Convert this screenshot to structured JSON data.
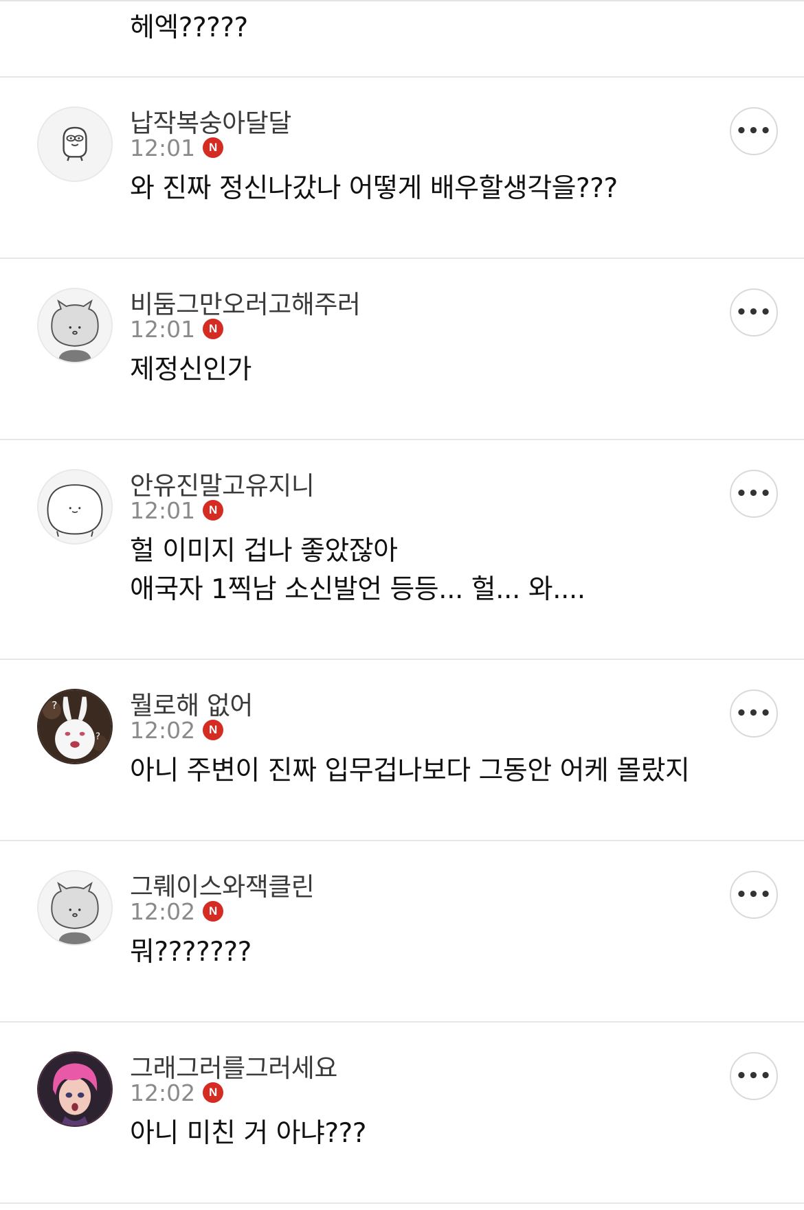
{
  "top_comment": {
    "text": "헤엑?????"
  },
  "comments": [
    {
      "nickname": "납작복숭아달달",
      "time": "12:01",
      "badge": "N",
      "lines": [
        "와 진짜 정신나갔나 어떻게 배우할생각을???"
      ],
      "avatar": "duck-avatar-icon"
    },
    {
      "nickname": "비둠그만오러고해주러",
      "time": "12:01",
      "badge": "N",
      "lines": [
        "제정신인가"
      ],
      "avatar": "cat-avatar-icon"
    },
    {
      "nickname": "안유진말고유지니",
      "time": "12:01",
      "badge": "N",
      "lines": [
        "헐 이미지 겁나 좋았잖아",
        "애국자 1찍남 소신발언 등등... 헐... 와...."
      ],
      "avatar": "blob-avatar-icon"
    },
    {
      "nickname": "뭘로해 없어",
      "time": "12:02",
      "badge": "N",
      "lines": [
        "아니 주변이 진짜 입무겁나보다 그동안 어케 몰랐지"
      ],
      "avatar": "bunny-photo-avatar"
    },
    {
      "nickname": "그뤠이스와잭클린",
      "time": "12:02",
      "badge": "N",
      "lines": [
        "뭐???????"
      ],
      "avatar": "cat-avatar-icon"
    },
    {
      "nickname": "그래그러를그러세요",
      "time": "12:02",
      "badge": "N",
      "lines": [
        "아니 미친 거 아냐???"
      ],
      "avatar": "pink-hair-photo-avatar"
    }
  ],
  "more_label": "•••"
}
